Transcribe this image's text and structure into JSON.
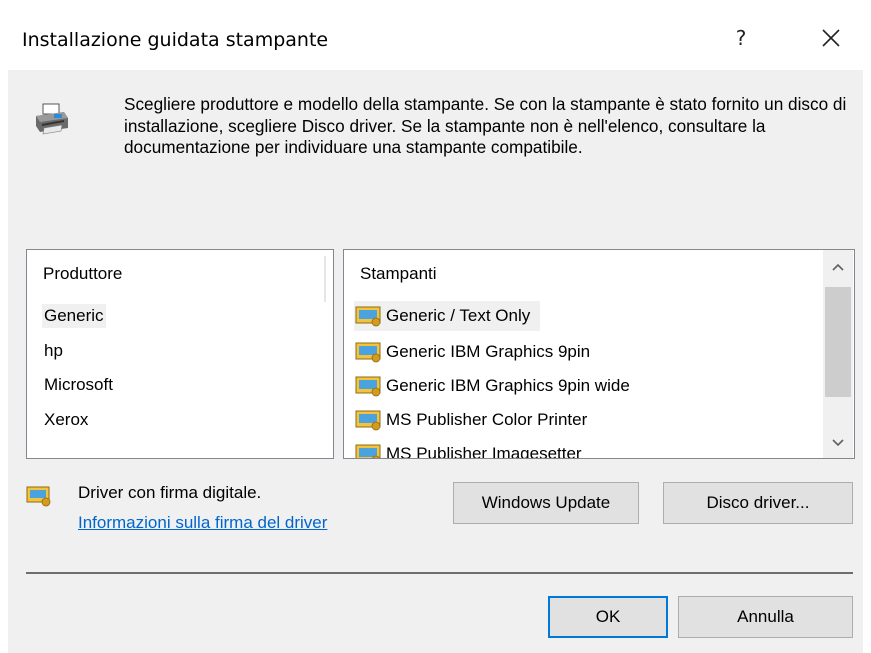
{
  "window": {
    "title": "Installazione guidata stampante",
    "help_label": "?",
    "close_icon": "close-icon"
  },
  "header": {
    "icon": "printer-icon",
    "description": "Scegliere produttore e modello della stampante. Se con la stampante è stato fornito un disco di installazione, scegliere Disco driver. Se la stampante non è nell'elenco, consultare la documentazione per individuare una stampante compatibile."
  },
  "manufacturers": {
    "header": "Produttore",
    "items": [
      "Generic",
      "hp",
      "Microsoft",
      "Xerox"
    ],
    "selected": "Generic"
  },
  "printers": {
    "header": "Stampanti",
    "items": [
      "Generic / Text Only",
      "Generic IBM Graphics 9pin",
      "Generic IBM Graphics 9pin wide",
      "MS Publisher Color Printer",
      "MS Publisher Imagesetter"
    ],
    "selected": "Generic / Text Only",
    "item_icon": "signed-driver-icon"
  },
  "signature": {
    "text": "Driver con firma digitale.",
    "link": "Informazioni sulla firma del driver"
  },
  "buttons": {
    "windows_update": "Windows Update",
    "disk": "Disco driver...",
    "ok": "OK",
    "cancel": "Annulla"
  },
  "colors": {
    "accent": "#0078d7",
    "link": "#0066cc",
    "dialog_bg": "#f0f0f0"
  }
}
